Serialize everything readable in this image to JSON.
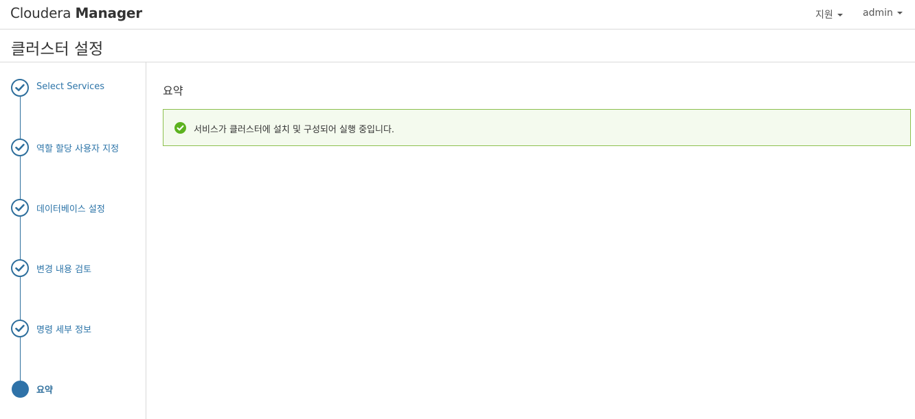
{
  "navbar": {
    "brand_light": "Cloudera",
    "brand_bold": "Manager",
    "support_label": "지원",
    "user_label": "admin"
  },
  "page": {
    "title": "클러스터 설정"
  },
  "wizard": {
    "steps": [
      {
        "label": "Select Services",
        "state": "completed"
      },
      {
        "label": "역할 할당 사용자 지정",
        "state": "completed"
      },
      {
        "label": "데이터베이스 설정",
        "state": "completed"
      },
      {
        "label": "변경 내용 검토",
        "state": "completed"
      },
      {
        "label": "명령 세부 정보",
        "state": "completed"
      },
      {
        "label": "요약",
        "state": "current"
      }
    ]
  },
  "main": {
    "section_title": "요약",
    "alert": {
      "type": "success",
      "icon": "check-circle-icon",
      "message": "서비스가 클러스터에 설치 및 구성되어 실행 중입니다."
    }
  },
  "colors": {
    "accent": "#2d6e9c",
    "success_border": "#8bbf4c",
    "success_bg": "#f4faee",
    "success_icon": "#5cb21f"
  }
}
